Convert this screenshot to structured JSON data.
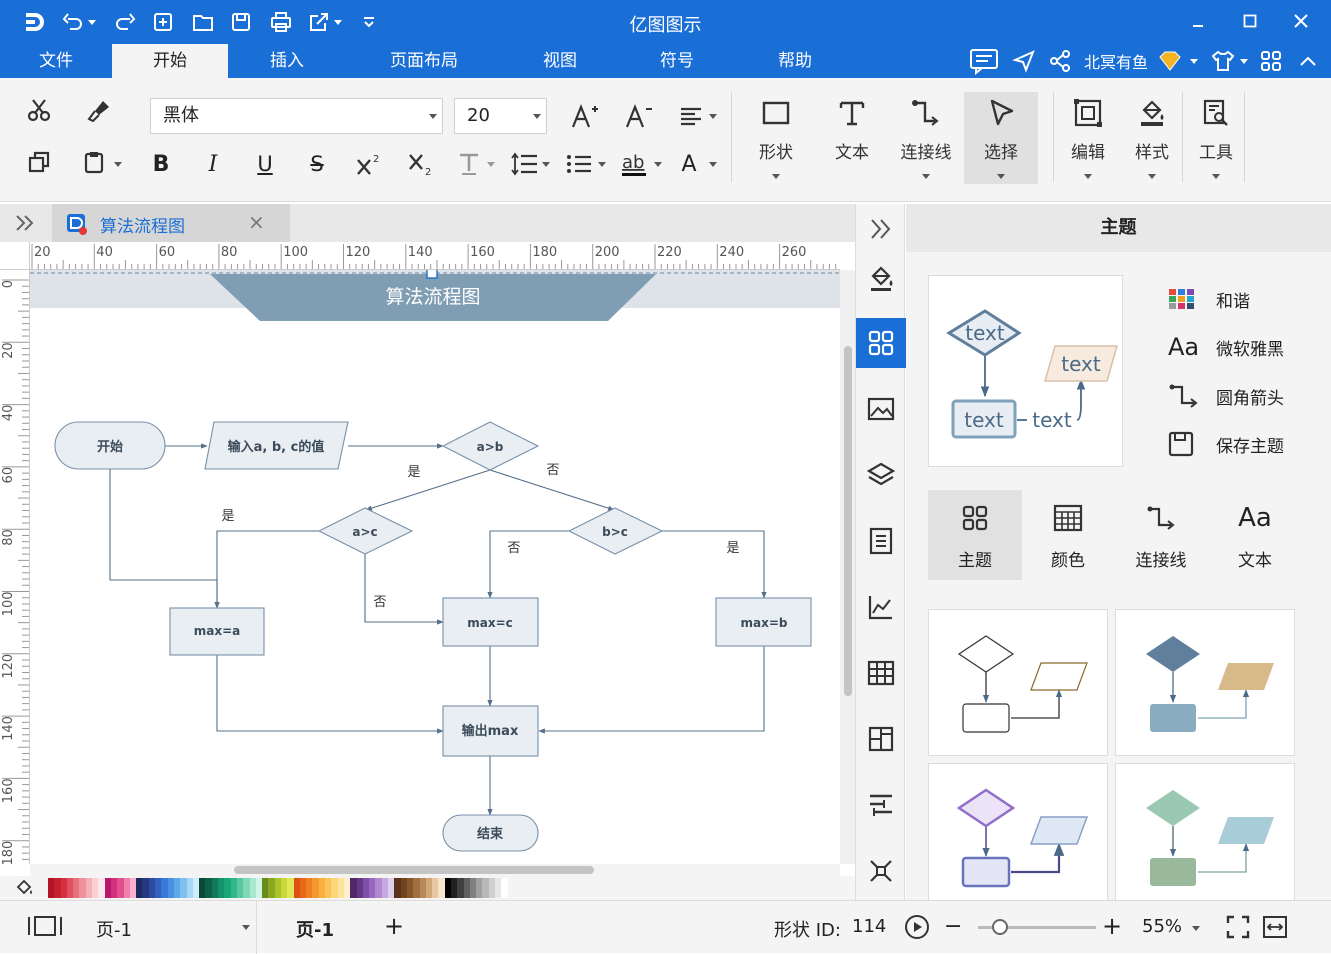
{
  "app": {
    "title": "亿图图示",
    "menu": [
      "文件",
      "开始",
      "插入",
      "页面布局",
      "视图",
      "符号",
      "帮助"
    ],
    "active_menu": "开始",
    "user_name": "北冥有鱼"
  },
  "ribbon": {
    "font_name": "黑体",
    "font_size": "20",
    "big_buttons": {
      "shape": "形状",
      "text": "文本",
      "connector": "连接线",
      "select": "选择",
      "edit": "编辑",
      "style": "样式",
      "tools": "工具"
    }
  },
  "document": {
    "tab_title": "算法流程图",
    "close_glyph": "×"
  },
  "rulers": {
    "horizontal": [
      "20",
      "40",
      "60",
      "80",
      "100",
      "120",
      "140",
      "160",
      "180",
      "200",
      "220",
      "240",
      "260"
    ],
    "vertical": [
      "0",
      "20",
      "40",
      "60",
      "80",
      "100",
      "120",
      "140",
      "160",
      "180"
    ]
  },
  "flowchart": {
    "title": "算法流程图",
    "nodes": {
      "start": "开始",
      "input": "输入a, b, c的值",
      "cond_ab": "a>b",
      "cond_ac": "a>c",
      "cond_bc": "b>c",
      "max_a": "max=a",
      "max_c": "max=c",
      "max_b": "max=b",
      "output": "输出max",
      "end": "结束"
    },
    "labels": {
      "ab_yes": "是",
      "ab_no": "否",
      "ac_yes": "是",
      "ac_no": "否",
      "bc_no": "否",
      "bc_yes": "是"
    }
  },
  "panel": {
    "title": "主题",
    "preview_words": [
      "text",
      "text",
      "text",
      "text"
    ],
    "options": [
      "和谐",
      "微软雅黑",
      "圆角箭头",
      "保存主题"
    ],
    "tabs": [
      "主题",
      "颜色",
      "连接线",
      "文本"
    ],
    "active_tab": "主题"
  },
  "status": {
    "page_selector": "页-1",
    "page_tab": "页-1",
    "add_page": "+",
    "shape_id_label": "形状 ID:",
    "shape_id": "114",
    "zoom": "55%",
    "zoom_level": 0.55
  },
  "colors": {
    "accent": "#1a6fd6",
    "node_fill": "#e9eef3",
    "node_stroke": "#7890a8",
    "title_band": "#7f9db3"
  }
}
